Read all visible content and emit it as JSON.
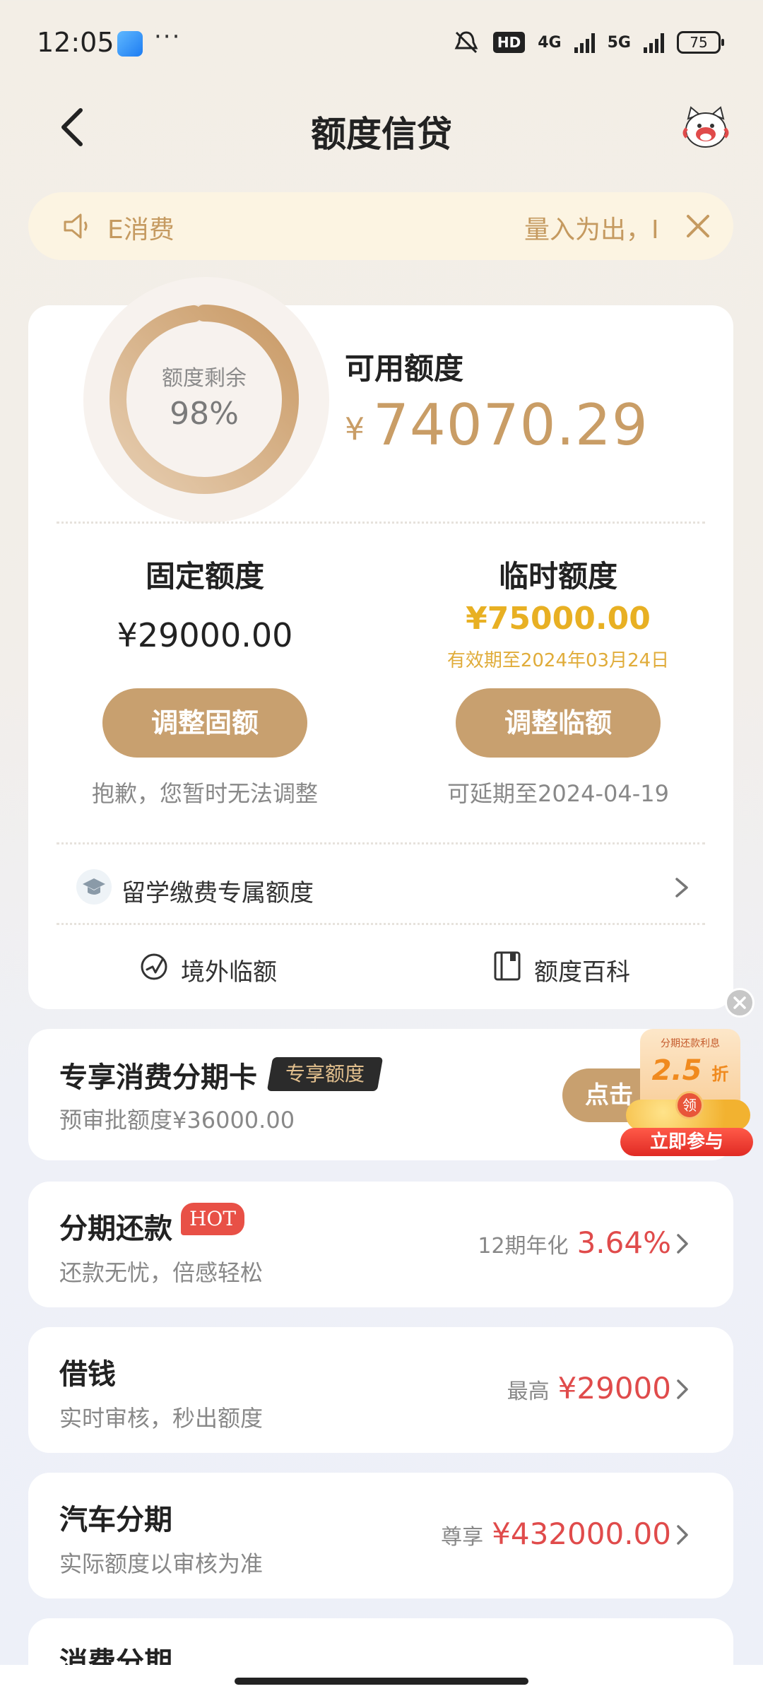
{
  "status_bar": {
    "time": "12:05",
    "dots": "···",
    "hd_label": "HD",
    "network_4g": "4G",
    "network_5g": "5G",
    "battery": "75"
  },
  "nav": {
    "title": "额度信贷"
  },
  "notice": {
    "text_left": "E消费",
    "text_right": "量入为出，I"
  },
  "credit": {
    "ring_label": "额度剩余",
    "ring_percent_text": "98%",
    "ring_fraction": 0.98,
    "available_label": "可用额度",
    "currency": "¥",
    "available_amount": "74070.29",
    "fixed_label": "固定额度",
    "fixed_amount": "¥29000.00",
    "temp_label": "临时额度",
    "temp_amount": "¥75000.00",
    "temp_valid": "有效期至2024年03月24日",
    "adjust_fixed_label": "调整固额",
    "adjust_temp_label": "调整临额",
    "fixed_note": "抱歉，您暂时无法调整",
    "temp_note": "可延期至2024-04-19",
    "study_label": "留学缴费专属额度",
    "abroad_label": "境外临额",
    "wiki_label": "额度百科"
  },
  "promo": {
    "title": "专享消费分期卡",
    "badge": "专享额度",
    "subtitle": "预审批额度¥36000.00",
    "button_label": "点击",
    "float_top": "分期还款利息",
    "float_discount": "2.5",
    "float_discount_unit": "折",
    "float_coin": "领",
    "float_join": "立即参与"
  },
  "products": [
    {
      "title": "分期还款",
      "subtitle": "还款无忧，倍感轻松",
      "prefix": "12期年化",
      "value": "3.64%",
      "badge": "HOT"
    },
    {
      "title": "借钱",
      "subtitle": "实时审核，秒出额度",
      "prefix": "最高",
      "value": "¥29000"
    },
    {
      "title": "汽车分期",
      "subtitle": "实际额度以审核为准",
      "prefix": "尊享",
      "value": "¥432000.00"
    }
  ],
  "last_card": {
    "title": "消费分期"
  },
  "colors": {
    "gold": "#c8a06f",
    "amount_gold": "#c99d66",
    "temp_yellow": "#e8b023",
    "red": "#e04b4b"
  }
}
